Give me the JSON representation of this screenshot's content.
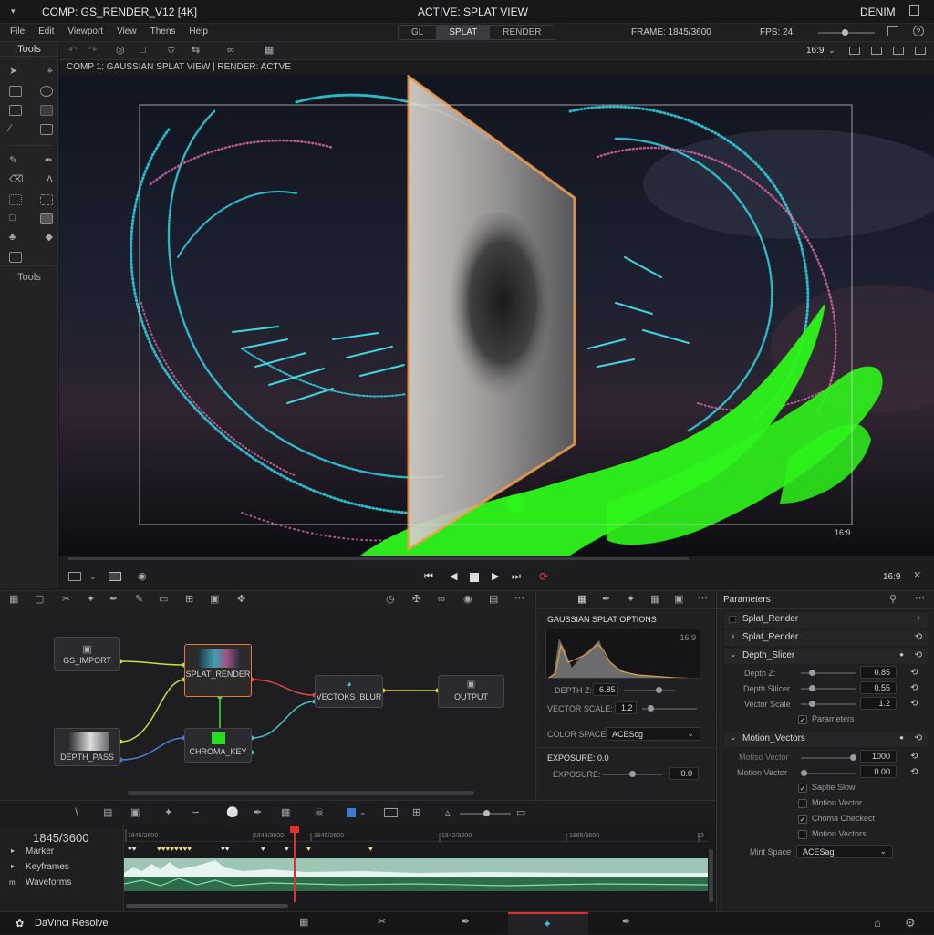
{
  "titlebar": {
    "comp_title": "COMP: GS_RENDER_V12 [4K]",
    "active_view": "ACTIVE: SPLAT VIEW",
    "workspace": "DENIM"
  },
  "menu": {
    "items": [
      "File",
      "Edit",
      "Viewport",
      "View",
      "Thens",
      "Help"
    ],
    "modes": [
      "GL",
      "SPLAT",
      "RENDER"
    ],
    "frame": "FRAME: 1845/3600",
    "fps": "FPS: 24"
  },
  "toolbar": {
    "aspect": "16:9"
  },
  "tools": {
    "title": "Tools",
    "footer": "Tools"
  },
  "viewer": {
    "header": "COMP 1: GAUSSIAN SPLAT VIEW  |  RENDER: ACTVE",
    "safe_label": "16:9",
    "aspect": "16:9"
  },
  "nodes": {
    "gs_import": "GS_IMPORT",
    "splat_render": "SPLAT_RENDER",
    "depth_pass": "DEPTH_PASS",
    "chroma_key": "CHROMA_KEY",
    "vectors_blur": "VECTOKS_BLUR",
    "output": "OUTPUT"
  },
  "gs_options": {
    "title": "GAUSSIAN SPLAT OPTIONS",
    "hist_label": "16:9",
    "depth_label": "DEPTH Z:",
    "depth_value": "6.85",
    "depth_level": 0.68,
    "vector_label": "VECTOR SCALE:",
    "vector_value": "1.2",
    "vector_level": 0.15,
    "color_label": "COLOR SPACE:",
    "color_value": "ACEScg",
    "exposure_title": "EXPOSURE: 0.0",
    "exposure_label": "EXPOSURE:",
    "exposure_value": "0.0",
    "exposure_level": 0.5
  },
  "params": {
    "title": "Parameters",
    "splat_render_1": "Splat_Render",
    "splat_render_2": "Splat_Render",
    "depth_slicer": {
      "title": "Depth_Slicer",
      "rows": [
        {
          "label": "Depth Z:",
          "value": "0.85",
          "level": 0.2
        },
        {
          "label": "Depth Silicer",
          "value": "0.55",
          "level": 0.2
        },
        {
          "label": "Vector Scale",
          "value": "1.2",
          "level": 0.2
        }
      ],
      "check_label": "Parameters",
      "check_on": true
    },
    "motion_vectors": {
      "title": "Motion_Vectors",
      "rows": [
        {
          "label": "Motiso Vector",
          "value": "1000",
          "level": 0.95
        },
        {
          "label": "Motion Vector",
          "value": "0.00",
          "level": 0.05
        }
      ],
      "checks": [
        {
          "label": "Saptie Slow",
          "on": true
        },
        {
          "label": "Motion Vector",
          "on": false
        },
        {
          "label": "Choma Checkect",
          "on": true
        },
        {
          "label": "Motion Vectors",
          "on": false
        }
      ],
      "mint_label": "Mint Space",
      "mint_value": "ACESag"
    }
  },
  "timeline": {
    "frame": "1845/3600",
    "ticks": [
      "1845/2600",
      "1843/3600",
      "1845/2600",
      "1842/3200",
      "1865/3600",
      "13"
    ],
    "tracks": [
      "Marker",
      "Keyframes",
      "Waveforms"
    ],
    "playhead_fraction": 0.29
  },
  "status": {
    "app": "DaVinci Resolve"
  },
  "colors": {
    "cyan": "#2fd6e6",
    "pink": "#e06aa8",
    "green": "#2df51a",
    "orange": "#f0a050"
  }
}
